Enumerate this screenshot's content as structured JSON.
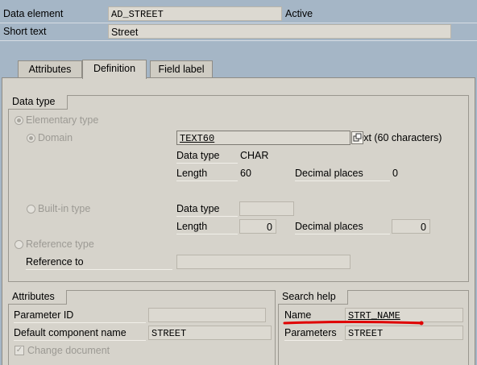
{
  "header": {
    "data_element_label": "Data element",
    "data_element_value": "AD_STREET",
    "status": "Active",
    "short_text_label": "Short text",
    "short_text_value": "Street"
  },
  "tabs": [
    {
      "label": "Attributes",
      "active": false
    },
    {
      "label": "Definition",
      "active": true
    },
    {
      "label": "Field label",
      "active": false
    }
  ],
  "data_type": {
    "title": "Data type",
    "elementary_label": "Elementary type",
    "domain_label": "Domain",
    "domain_value": "TEXT60",
    "domain_desc": "Text (60 characters)",
    "domain_data_type_label": "Data type",
    "domain_data_type_value": "CHAR",
    "domain_length_label": "Length",
    "domain_length_value": "60",
    "domain_decimal_label": "Decimal places",
    "domain_decimal_value": "0",
    "builtin_label": "Built-in type",
    "builtin_data_type_label": "Data type",
    "builtin_length_label": "Length",
    "builtin_length_value": "0",
    "builtin_decimal_label": "Decimal places",
    "builtin_decimal_value": "0",
    "reference_type_label": "Reference type",
    "reference_to_label": "Reference to"
  },
  "attributes": {
    "title": "Attributes",
    "parameter_id_label": "Parameter ID",
    "default_component_label": "Default component name",
    "default_component_value": "STREET",
    "change_document_label": "Change document",
    "change_document_checked": true
  },
  "search_help": {
    "title": "Search help",
    "name_label": "Name",
    "name_value": "STRT_NAME",
    "parameters_label": "Parameters",
    "parameters_value": "STREET"
  },
  "colors": {
    "background": "#a5b6c6",
    "panel": "#d6d3cb",
    "annotation": "#e00000"
  }
}
